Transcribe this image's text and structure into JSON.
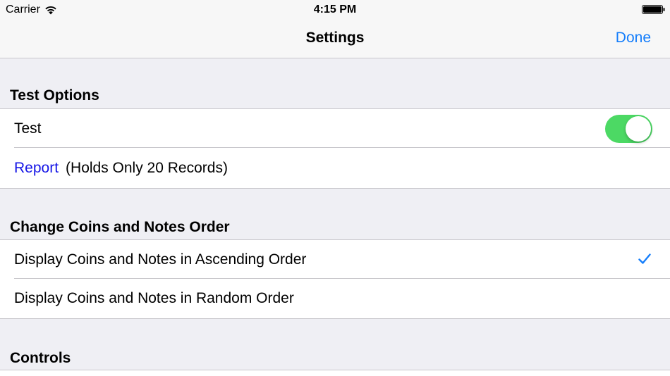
{
  "status_bar": {
    "carrier": "Carrier",
    "time": "4:15 PM"
  },
  "nav": {
    "title": "Settings",
    "done_label": "Done"
  },
  "sections": {
    "test_options": {
      "header": "Test Options",
      "test_label": "Test",
      "test_enabled": true,
      "report_label": "Report",
      "report_note": "(Holds Only 20 Records)"
    },
    "order": {
      "header": "Change Coins and Notes Order",
      "ascending_label": "Display Coins and Notes in Ascending Order",
      "ascending_selected": true,
      "random_label": "Display Coins and Notes in Random Order",
      "random_selected": false
    },
    "controls": {
      "header": "Controls"
    }
  },
  "colors": {
    "accent": "#157efb",
    "toggle_on": "#4cd964",
    "link": "#1515e6",
    "grouped_background": "#efeff4"
  },
  "icons": [
    "wifi-icon",
    "battery-icon",
    "checkmark-icon"
  ]
}
